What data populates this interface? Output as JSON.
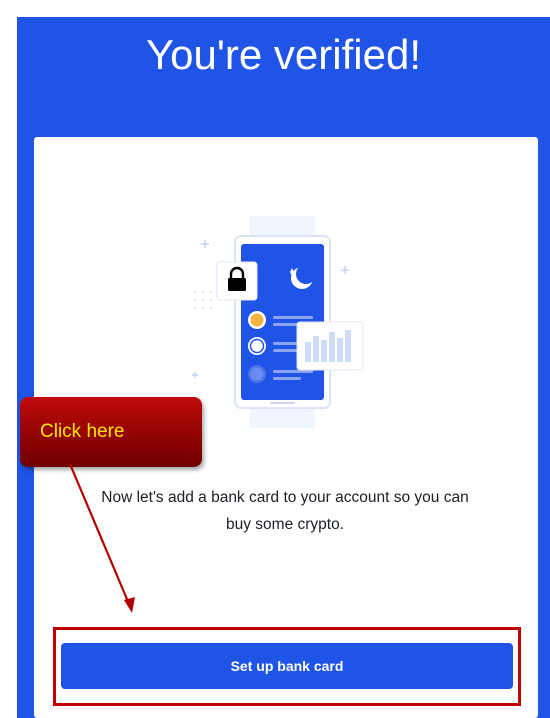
{
  "header": {
    "title": "You're verified!"
  },
  "card": {
    "illustration_icon": "phone-wallet-illustration",
    "message": "Now let's add a bank card to your account so you can buy some crypto.",
    "button_label": "Set up bank card"
  },
  "annotation": {
    "callout_text": "Click here"
  },
  "colors": {
    "brand_blue": "#1f54e6",
    "annotation_red": "#c00000",
    "callout_text": "#ffe600"
  }
}
